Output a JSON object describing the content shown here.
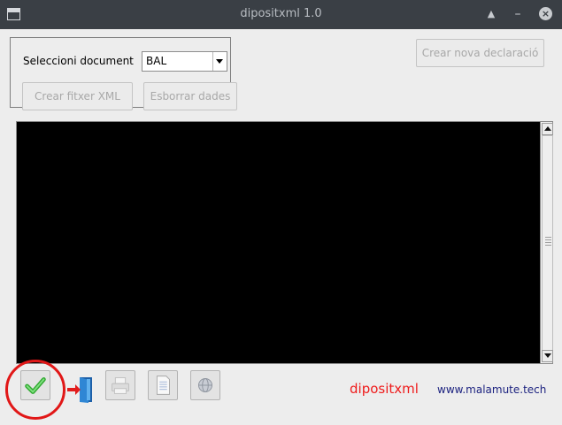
{
  "window": {
    "title": "dipositxml 1.0"
  },
  "toolbar": {
    "select_label": "Seleccioni document",
    "select_value": "BAL",
    "create_xml_label": "Crear fitxer XML",
    "delete_data_label": "Esborrar dades",
    "new_declaration_label": "Crear nova declaració"
  },
  "bottom": {
    "brand": "dipositxml",
    "url": "www.malamute.tech"
  },
  "icons": {
    "confirm": "check-icon",
    "exit": "exit-door-icon",
    "print": "printer-icon",
    "document": "document-icon",
    "globe": "globe-icon"
  },
  "colors": {
    "brand": "#ee1c1c",
    "url": "#1d2380",
    "highlight": "#e11717",
    "console": "#000000"
  }
}
